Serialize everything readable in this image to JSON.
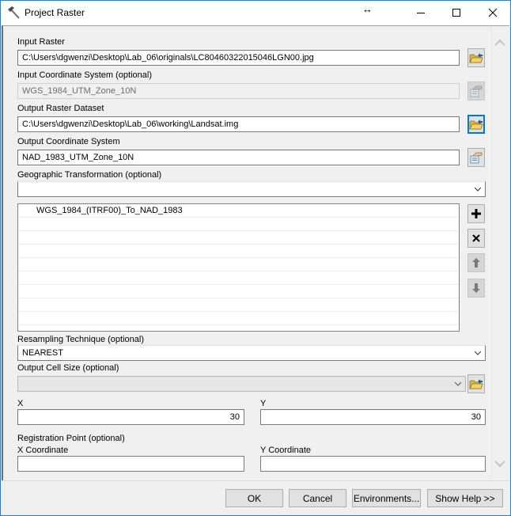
{
  "window": {
    "title": "Project Raster",
    "title_icon": "hammer-icon",
    "controls": {
      "resize": "↔",
      "minimize": "minimize-icon",
      "maximize": "maximize-icon",
      "close": "close-icon"
    }
  },
  "form": {
    "input_raster": {
      "label": "Input Raster",
      "value": "C:\\Users\\dgwenzi\\Desktop\\Lab_06\\originals\\LC80460322015046LGN00.jpg"
    },
    "input_coord_system": {
      "label": "Input Coordinate System (optional)",
      "value": "WGS_1984_UTM_Zone_10N",
      "enabled": false
    },
    "output_raster_dataset": {
      "label": "Output Raster Dataset",
      "value": "C:\\Users\\dgwenzi\\Desktop\\Lab_06\\working\\Landsat.img"
    },
    "output_coord_system": {
      "label": "Output Coordinate System",
      "value": "NAD_1983_UTM_Zone_10N"
    },
    "geographic_transformation": {
      "label": "Geographic Transformation (optional)",
      "value": "",
      "list_items": [
        "WGS_1984_(ITRF00)_To_NAD_1983",
        "",
        "",
        "",
        "",
        "",
        "",
        "",
        ""
      ]
    },
    "resampling": {
      "label": "Resampling Technique (optional)",
      "value": "NEAREST"
    },
    "output_cell_size": {
      "label": "Output Cell Size (optional)",
      "value": "",
      "enabled": false
    },
    "cell_x": {
      "label": "X",
      "value": "30"
    },
    "cell_y": {
      "label": "Y",
      "value": "30"
    },
    "registration_point": {
      "label": "Registration Point (optional)",
      "x_label": "X Coordinate",
      "x_value": "",
      "y_label": "Y Coordinate",
      "y_value": ""
    }
  },
  "list_buttons": {
    "add": "plus-icon",
    "remove": "x-icon",
    "up": "arrow-up-icon",
    "down": "arrow-down-icon"
  },
  "footer": {
    "ok": "OK",
    "cancel": "Cancel",
    "environments": "Environments...",
    "show_help": "Show Help >>"
  },
  "colors": {
    "accent": "#0078d7",
    "window_border": "#1883d7",
    "background": "#f0f0f0"
  }
}
